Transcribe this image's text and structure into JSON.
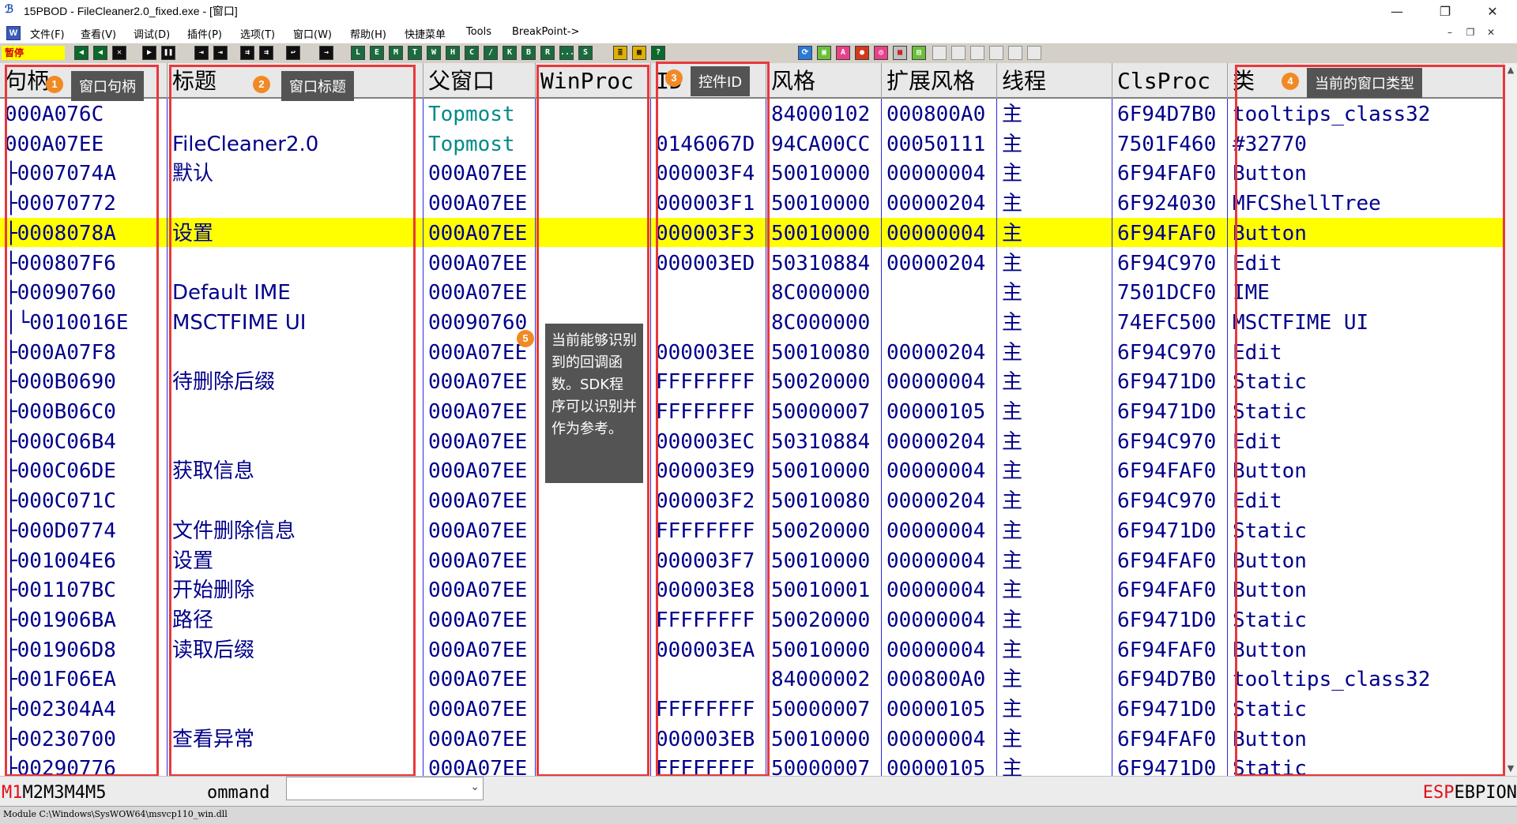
{
  "window": {
    "title": "15PBOD - FileCleaner2.0_fixed.exe - [窗口]",
    "app_icon": "15pbod-logo-icon",
    "minimize": "—",
    "restore": "❐",
    "close": "✕"
  },
  "menu": {
    "items": [
      "文件(F)",
      "查看(V)",
      "调试(D)",
      "插件(P)",
      "选项(T)",
      "窗口(W)",
      "帮助(H)",
      "快捷菜单",
      "Tools",
      "BreakPoint->"
    ],
    "mdi_minimize": "–",
    "mdi_restore": "❐",
    "mdi_close": "✕"
  },
  "toolbar": {
    "status": "暂停",
    "letters": [
      "L",
      "E",
      "M",
      "T",
      "W",
      "H",
      "C",
      "/",
      "K",
      "B",
      "R",
      "...",
      "S"
    ]
  },
  "grid": {
    "columns": [
      "句柄",
      "标题",
      "父窗口",
      "WinProc",
      "ID",
      "风格",
      "扩展风格",
      "线程",
      "ClsProc",
      "类"
    ],
    "rows": [
      {
        "handle": "000A076C",
        "title": "",
        "parent": "Topmost",
        "winproc": "",
        "id": "",
        "style": "84000102",
        "exstyle": "000800A0",
        "thread": "主",
        "clsproc": "6F94D7B0",
        "cls": "tooltips_class32"
      },
      {
        "handle": "000A07EE",
        "title": "FileCleaner2.0",
        "parent": "Topmost",
        "winproc": "",
        "id": "0146067D",
        "style": "94CA00CC",
        "exstyle": "00050111",
        "thread": "主",
        "clsproc": "7501F460",
        "cls": "#32770"
      },
      {
        "handle": "├0007074A",
        "title": "默认",
        "parent": "000A07EE",
        "winproc": "",
        "id": "000003F4",
        "style": "50010000",
        "exstyle": "00000004",
        "thread": "主",
        "clsproc": "6F94FAF0",
        "cls": "Button"
      },
      {
        "handle": "├00070772",
        "title": "",
        "parent": "000A07EE",
        "winproc": "",
        "id": "000003F1",
        "style": "50010000",
        "exstyle": "00000204",
        "thread": "主",
        "clsproc": "6F924030",
        "cls": "MFCShellTree"
      },
      {
        "handle": "├0008078A",
        "title": "设置",
        "parent": "000A07EE",
        "winproc": "",
        "id": "000003F3",
        "style": "50010000",
        "exstyle": "00000004",
        "thread": "主",
        "clsproc": "6F94FAF0",
        "cls": "Button",
        "selected": true
      },
      {
        "handle": "├000807F6",
        "title": "",
        "parent": "000A07EE",
        "winproc": "",
        "id": "000003ED",
        "style": "50310884",
        "exstyle": "00000204",
        "thread": "主",
        "clsproc": "6F94C970",
        "cls": "Edit"
      },
      {
        "handle": "├00090760",
        "title": "Default IME",
        "parent": "000A07EE",
        "winproc": "",
        "id": "",
        "style": "8C000000",
        "exstyle": "",
        "thread": "主",
        "clsproc": "7501DCF0",
        "cls": "IME"
      },
      {
        "handle": "│└0010016E",
        "title": "MSCTFIME UI",
        "parent": "00090760",
        "winproc": "",
        "id": "",
        "style": "8C000000",
        "exstyle": "",
        "thread": "主",
        "clsproc": "74EFC500",
        "cls": "MSCTFIME UI"
      },
      {
        "handle": "├000A07F8",
        "title": "",
        "parent": "000A07EE",
        "winproc": "",
        "id": "000003EE",
        "style": "50010080",
        "exstyle": "00000204",
        "thread": "主",
        "clsproc": "6F94C970",
        "cls": "Edit"
      },
      {
        "handle": "├000B0690",
        "title": "待删除后缀",
        "parent": "000A07EE",
        "winproc": "",
        "id": "FFFFFFFF",
        "style": "50020000",
        "exstyle": "00000004",
        "thread": "主",
        "clsproc": "6F9471D0",
        "cls": "Static"
      },
      {
        "handle": "├000B06C0",
        "title": "",
        "parent": "000A07EE",
        "winproc": "",
        "id": "FFFFFFFF",
        "style": "50000007",
        "exstyle": "00000105",
        "thread": "主",
        "clsproc": "6F9471D0",
        "cls": "Static"
      },
      {
        "handle": "├000C06B4",
        "title": "",
        "parent": "000A07EE",
        "winproc": "",
        "id": "000003EC",
        "style": "50310884",
        "exstyle": "00000204",
        "thread": "主",
        "clsproc": "6F94C970",
        "cls": "Edit"
      },
      {
        "handle": "├000C06DE",
        "title": "获取信息",
        "parent": "000A07EE",
        "winproc": "",
        "id": "000003E9",
        "style": "50010000",
        "exstyle": "00000004",
        "thread": "主",
        "clsproc": "6F94FAF0",
        "cls": "Button"
      },
      {
        "handle": "├000C071C",
        "title": "",
        "parent": "000A07EE",
        "winproc": "",
        "id": "000003F2",
        "style": "50010080",
        "exstyle": "00000204",
        "thread": "主",
        "clsproc": "6F94C970",
        "cls": "Edit"
      },
      {
        "handle": "├000D0774",
        "title": "文件删除信息",
        "parent": "000A07EE",
        "winproc": "",
        "id": "FFFFFFFF",
        "style": "50020000",
        "exstyle": "00000004",
        "thread": "主",
        "clsproc": "6F9471D0",
        "cls": "Static"
      },
      {
        "handle": "├001004E6",
        "title": "设置",
        "parent": "000A07EE",
        "winproc": "",
        "id": "000003F7",
        "style": "50010000",
        "exstyle": "00000004",
        "thread": "主",
        "clsproc": "6F94FAF0",
        "cls": "Button"
      },
      {
        "handle": "├001107BC",
        "title": "开始删除",
        "parent": "000A07EE",
        "winproc": "",
        "id": "000003E8",
        "style": "50010001",
        "exstyle": "00000004",
        "thread": "主",
        "clsproc": "6F94FAF0",
        "cls": "Button"
      },
      {
        "handle": "├001906BA",
        "title": "路径",
        "parent": "000A07EE",
        "winproc": "",
        "id": "FFFFFFFF",
        "style": "50020000",
        "exstyle": "00000004",
        "thread": "主",
        "clsproc": "6F9471D0",
        "cls": "Static"
      },
      {
        "handle": "├001906D8",
        "title": "读取后缀",
        "parent": "000A07EE",
        "winproc": "",
        "id": "000003EA",
        "style": "50010000",
        "exstyle": "00000004",
        "thread": "主",
        "clsproc": "6F94FAF0",
        "cls": "Button"
      },
      {
        "handle": "├001F06EA",
        "title": "",
        "parent": "000A07EE",
        "winproc": "",
        "id": "",
        "style": "84000002",
        "exstyle": "000800A0",
        "thread": "主",
        "clsproc": "6F94D7B0",
        "cls": "tooltips_class32"
      },
      {
        "handle": "├002304A4",
        "title": "",
        "parent": "000A07EE",
        "winproc": "",
        "id": "FFFFFFFF",
        "style": "50000007",
        "exstyle": "00000105",
        "thread": "主",
        "clsproc": "6F9471D0",
        "cls": "Static"
      },
      {
        "handle": "├00230700",
        "title": "查看异常",
        "parent": "000A07EE",
        "winproc": "",
        "id": "000003EB",
        "style": "50010000",
        "exstyle": "00000004",
        "thread": "主",
        "clsproc": "6F94FAF0",
        "cls": "Button"
      },
      {
        "handle": "├00290776",
        "title": "",
        "parent": "000A07EE",
        "winproc": "",
        "id": "FFFFFFFF",
        "style": "50000007",
        "exstyle": "00000105",
        "thread": "主",
        "clsproc": "6F9471D0",
        "cls": "Static"
      }
    ]
  },
  "annotations": [
    {
      "num": "1",
      "text": "窗口句柄"
    },
    {
      "num": "2",
      "text": "窗口标题"
    },
    {
      "num": "3",
      "text": "控件ID"
    },
    {
      "num": "4",
      "text": "当前的窗口类型"
    },
    {
      "num": "5",
      "text": "当前能够识别到的回调函数。SDK程序可以识别并作为参考。"
    }
  ],
  "cmdbar": {
    "m_active": "M1",
    "m_rest": "M2M3M4M5",
    "label": "ommand",
    "esp_active": "ESP",
    "esp_rest": "EBPION"
  },
  "status": {
    "text": "Module C:\\Windows\\SysWOW64\\msvcp110_win.dll"
  },
  "colors": {
    "selected_row": "#ffff00",
    "annotation_red": "#e8383c",
    "text_blue": "#00008b",
    "topmost_teal": "#008a8a",
    "badge_orange": "#f08a24"
  }
}
